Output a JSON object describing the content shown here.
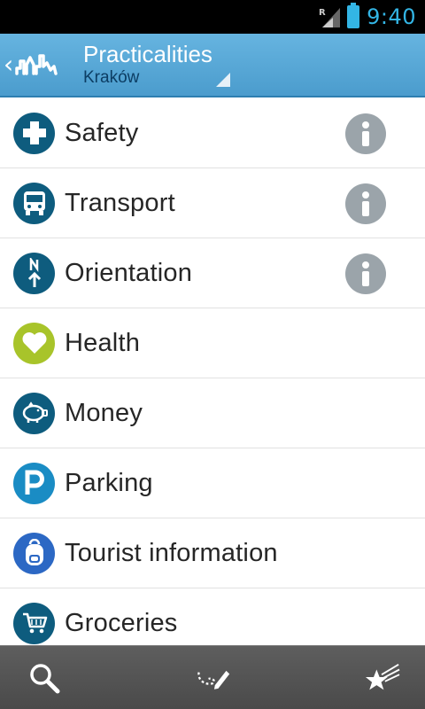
{
  "status_bar": {
    "time": "9:40",
    "signal_icon": "signal-roaming-icon",
    "battery_icon": "battery-full-icon",
    "accent_color": "#33b5e5"
  },
  "action_bar": {
    "title": "Practicalities",
    "subtitle": "Kraków",
    "logo_icon": "city-skyline-logo-icon",
    "background_color": "#57a8d8"
  },
  "list": {
    "items": [
      {
        "label": "Safety",
        "icon": "plus-cross-icon",
        "color": "#0e5c7e",
        "has_info": true
      },
      {
        "label": "Transport",
        "icon": "bus-icon",
        "color": "#0e5c7e",
        "has_info": true
      },
      {
        "label": "Orientation",
        "icon": "north-arrow-icon",
        "color": "#0e5c7e",
        "has_info": true
      },
      {
        "label": "Health",
        "icon": "heart-icon",
        "color": "#a8c42a",
        "has_info": false
      },
      {
        "label": "Money",
        "icon": "piggy-bank-icon",
        "color": "#0e5c7e",
        "has_info": false
      },
      {
        "label": "Parking",
        "icon": "parking-p-icon",
        "color": "#1a8cc4",
        "has_info": false
      },
      {
        "label": "Tourist information",
        "icon": "backpack-icon",
        "color": "#2c68c4",
        "has_info": false
      },
      {
        "label": "Groceries",
        "icon": "shopping-cart-icon",
        "color": "#0e5c7e",
        "has_info": false
      }
    ],
    "info_icon": "info-icon",
    "info_color": "#9ba4aa"
  },
  "bottom_bar": {
    "buttons": [
      {
        "icon": "search-icon"
      },
      {
        "icon": "route-pencil-icon"
      },
      {
        "icon": "starred-icon"
      }
    ]
  }
}
